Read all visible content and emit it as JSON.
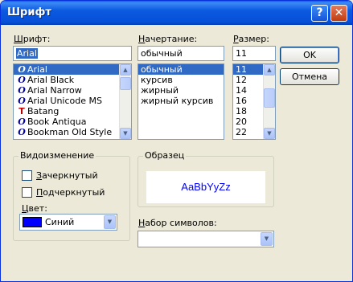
{
  "dialog": {
    "title": "Шрифт",
    "help_glyph": "?",
    "close_glyph": "✕"
  },
  "font": {
    "label_underlined": "Ш",
    "label_rest": "рифт:",
    "value": "Arial",
    "items": [
      {
        "name": "Arial",
        "icon": "opentype-font-icon",
        "glyph": "O",
        "selected": true
      },
      {
        "name": "Arial Black",
        "icon": "opentype-font-icon",
        "glyph": "O",
        "selected": false
      },
      {
        "name": "Arial Narrow",
        "icon": "opentype-font-icon",
        "glyph": "O",
        "selected": false
      },
      {
        "name": "Arial Unicode MS",
        "icon": "opentype-font-icon",
        "glyph": "O",
        "selected": false
      },
      {
        "name": "Batang",
        "icon": "truetype-font-icon",
        "glyph": "T",
        "selected": false
      },
      {
        "name": "Book Antiqua",
        "icon": "opentype-font-icon",
        "glyph": "O",
        "selected": false
      },
      {
        "name": "Bookman Old Style",
        "icon": "opentype-font-icon",
        "glyph": "O",
        "selected": false
      }
    ]
  },
  "style": {
    "label_underlined": "Н",
    "label_rest": "ачертание:",
    "value": "обычный",
    "items": [
      {
        "name": "обычный",
        "selected": true
      },
      {
        "name": "курсив",
        "selected": false
      },
      {
        "name": "жирный",
        "selected": false
      },
      {
        "name": "жирный курсив",
        "selected": false
      }
    ]
  },
  "size": {
    "label_underlined": "Р",
    "label_rest": "азмер:",
    "value": "11",
    "items": [
      {
        "name": "11",
        "selected": true
      },
      {
        "name": "12",
        "selected": false
      },
      {
        "name": "14",
        "selected": false
      },
      {
        "name": "16",
        "selected": false
      },
      {
        "name": "18",
        "selected": false
      },
      {
        "name": "20",
        "selected": false
      },
      {
        "name": "22",
        "selected": false
      }
    ]
  },
  "buttons": {
    "ok": "OK",
    "cancel": "Отмена"
  },
  "effects": {
    "title": "Видоизменение",
    "strikeout": {
      "underlined": "З",
      "rest": "ачеркнутый",
      "checked": false
    },
    "underline": {
      "underlined": "П",
      "rest": "одчеркнутый",
      "checked": false
    },
    "color_label_underlined": "Ц",
    "color_label_rest": "вет:",
    "color_value": "Синий",
    "color_hex": "#0000ff"
  },
  "sample": {
    "title": "Образец",
    "text": "AaBbYyZz",
    "text_color": "#0000ff"
  },
  "charset": {
    "label_underlined": "Н",
    "label_rest": "абор символов:",
    "value": ""
  },
  "colors": {
    "selection": "#316ac5",
    "titlebar": "#0650d8"
  },
  "icons": {
    "scroll_up": "▲",
    "scroll_down": "▼",
    "dropdown": "▼"
  }
}
